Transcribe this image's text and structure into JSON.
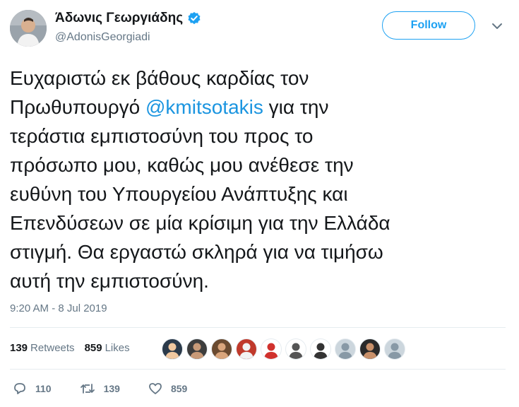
{
  "author": {
    "display_name": "Άδωνις Γεωργιάδης",
    "handle": "@AdonisGeorgiadi",
    "verified_icon": "verified-badge-icon"
  },
  "follow_button": {
    "label": "Follow"
  },
  "tweet": {
    "text_parts": [
      "Ευχαριστώ εκ βάθους καρδίας τον\nΠρωθυπουργό ",
      "@kmitsotakis",
      " για την\nτεράστια εμπιστοσύνη του προς το\nπρόσωπο μου, καθώς μου ανέθεσε την\nευθύνη του Υπουργείου Ανάπτυξης και\nΕπενδύσεων σε μία κρίσιμη για την Ελλάδα\nστιγμή. Θα εργαστώ σκληρά για να τιμήσω\nαυτή την εμπιστοσύνη."
    ],
    "timestamp": "9:20 AM - 8 Jul 2019"
  },
  "stats": {
    "retweets_count": "139",
    "retweets_label": "Retweets",
    "likes_count": "859",
    "likes_label": "Likes"
  },
  "likers": [
    {
      "name": "liker-avatar-1",
      "bg": "#2b3a4a",
      "fg": "#f0c8a0"
    },
    {
      "name": "liker-avatar-2",
      "bg": "#3d3d3d",
      "fg": "#c89a78"
    },
    {
      "name": "liker-avatar-3",
      "bg": "#6a4a30",
      "fg": "#d9a57c"
    },
    {
      "name": "liker-avatar-4",
      "bg": "#c0392b",
      "fg": "#f2f2f2"
    },
    {
      "name": "liker-avatar-5",
      "bg": "#ffffff",
      "fg": "#d0312d"
    },
    {
      "name": "liker-avatar-6",
      "bg": "#ffffff",
      "fg": "#555555"
    },
    {
      "name": "liker-avatar-7",
      "bg": "#ffffff",
      "fg": "#333333"
    },
    {
      "name": "liker-avatar-8",
      "bg": "#ccd6dd",
      "fg": "#8899a6"
    },
    {
      "name": "liker-avatar-9",
      "bg": "#2a2a2a",
      "fg": "#c8906a"
    },
    {
      "name": "liker-avatar-10",
      "bg": "#ccd6dd",
      "fg": "#8899a6"
    }
  ],
  "actions": {
    "reply_count": "110",
    "retweet_count": "139",
    "like_count": "859"
  },
  "colors": {
    "accent": "#1da1f2",
    "mention": "#1b95e0",
    "muted": "#657786",
    "text": "#14171a"
  }
}
